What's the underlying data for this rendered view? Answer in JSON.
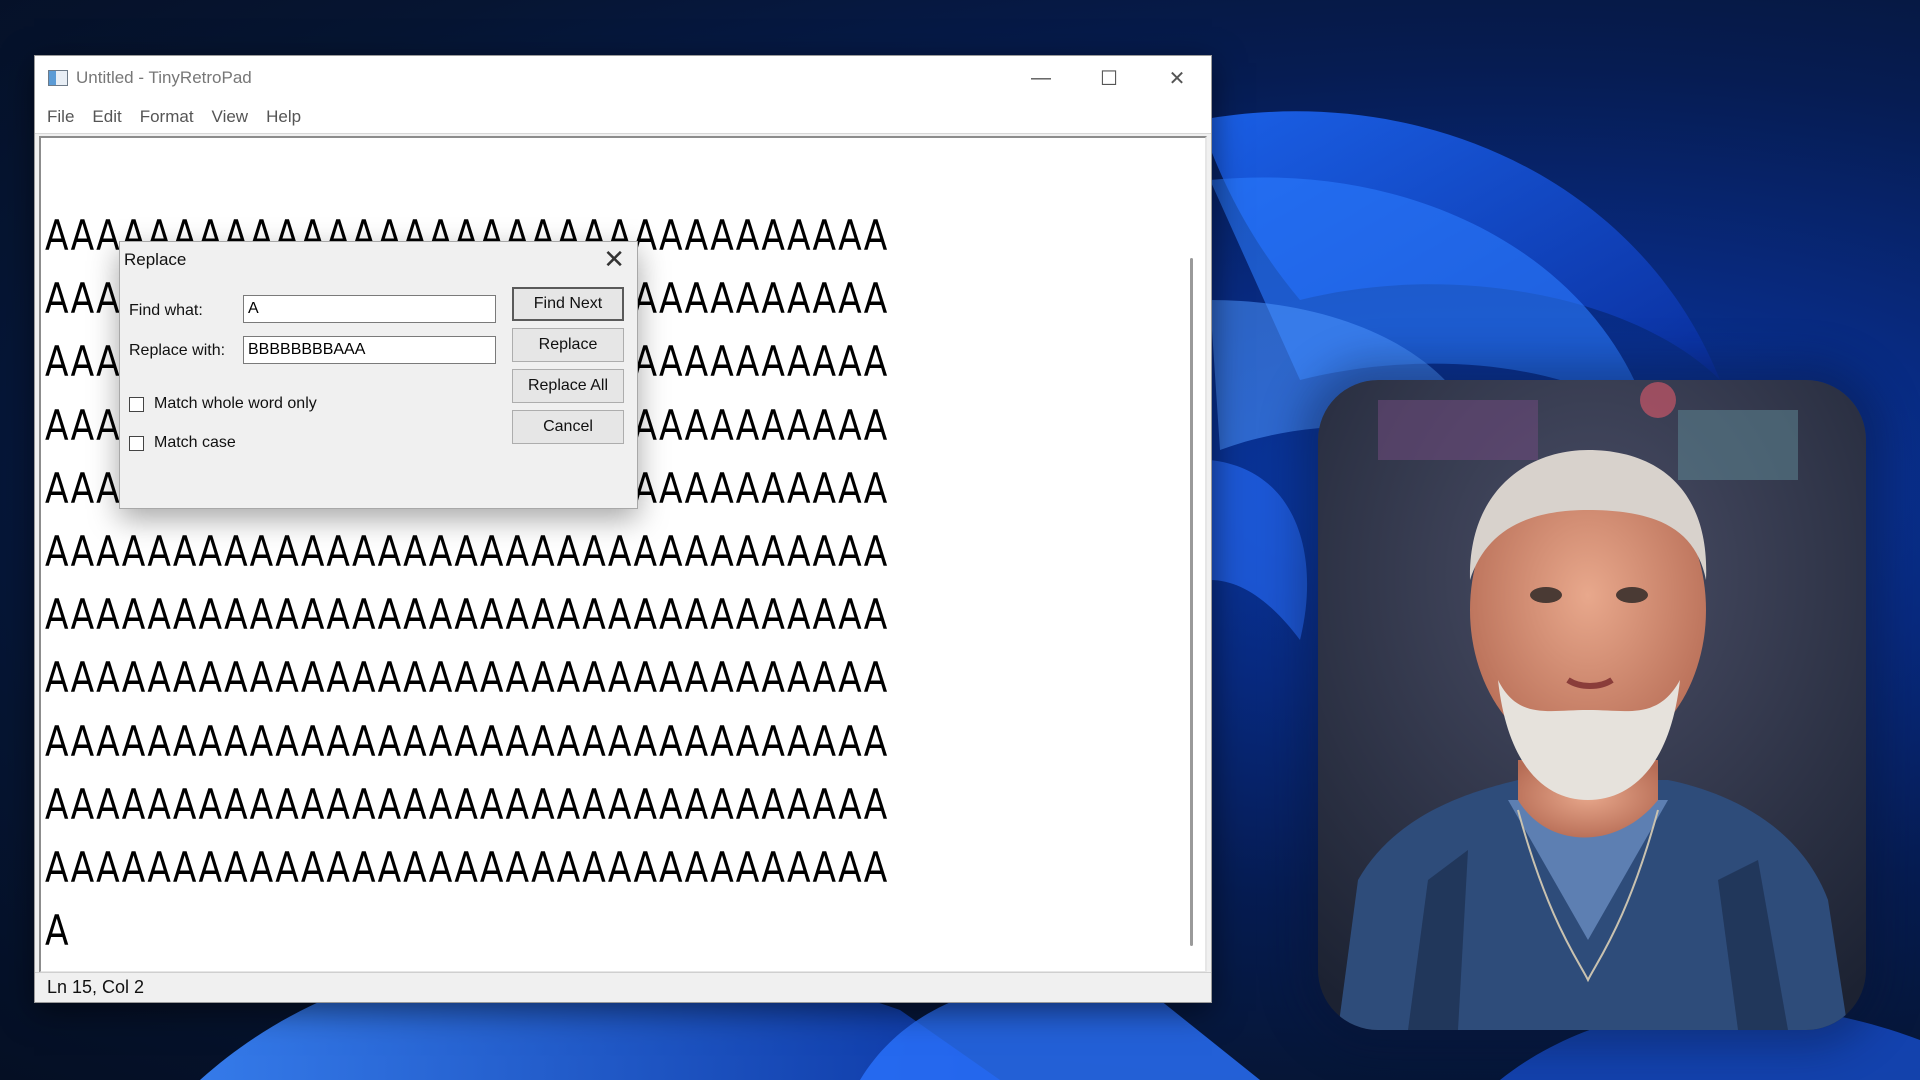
{
  "window": {
    "title": "Untitled - TinyRetroPad",
    "controls": {
      "minimize": "—",
      "maximize": "☐",
      "close": "✕"
    }
  },
  "menu": [
    "File",
    "Edit",
    "Format",
    "View",
    "Help"
  ],
  "editor": {
    "lines": [
      "AAAAAAAAAAAAAAAAAAAAAAAAAAAAAAAAA",
      "AAAAAAAAAAAAAAAAAAAAAAAAAAAAAAAAA",
      "AAAAAAAAAAAAAAAAAAAAAAAAAAAAAAAAA",
      "AAAAAAAAAAAAAAAAAAAAAAAAAAAAAAAAA",
      "AAAAAAAAAAAAAAAAAAAAAAAAAAAAAAAAA",
      "AAAAAAAAAAAAAAAAAAAAAAAAAAAAAAAAA",
      "AAAAAAAAAAAAAAAAAAAAAAAAAAAAAAAAA",
      "AAAAAAAAAAAAAAAAAAAAAAAAAAAAAAAAA",
      "AAAAAAAAAAAAAAAAAAAAAAAAAAAAAAAAA",
      "AAAAAAAAAAAAAAAAAAAAAAAAAAAAAAAAA",
      "AAAAAAAAAAAAAAAAAAAAAAAAAAAAAAAAA",
      "A"
    ]
  },
  "status": {
    "position": "Ln 15, Col 2"
  },
  "dialog": {
    "title": "Replace",
    "close": "✕",
    "find_label": "Find what:",
    "find_value": "A",
    "replace_label": "Replace with:",
    "replace_value": "BBBBBBBBAAA",
    "match_whole_word": {
      "label": "Match whole word only",
      "checked": false
    },
    "match_case": {
      "label": "Match case",
      "checked": false
    },
    "buttons": {
      "find_next": "Find Next",
      "replace": "Replace",
      "replace_all": "Replace All",
      "cancel": "Cancel"
    }
  },
  "colors": {
    "accent": "#0a3aa8",
    "window_bg": "#f0f0f0",
    "editor_bg": "#ffffff"
  }
}
